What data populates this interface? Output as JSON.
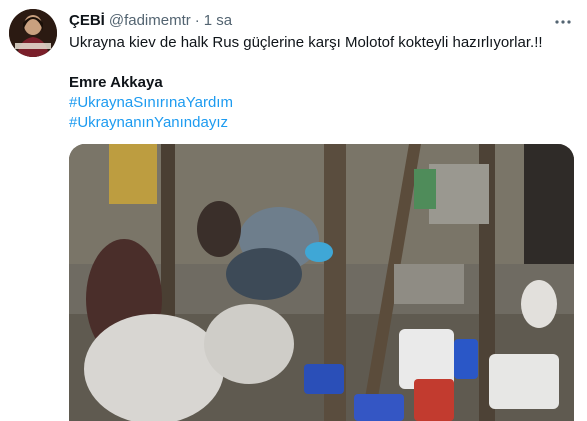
{
  "tweet": {
    "display_name": "ÇEBİ",
    "handle": "@fadimemtr",
    "separator": "·",
    "timestamp": "1 sa",
    "text": "Ukrayna kiev de halk Rus güçlerine karşı Molotof kokteyli hazırlıyorlar.!!",
    "author_line": "Emre Akkaya",
    "hashtags": [
      "#UkraynaSınırınaYardım",
      "#UkraynanınYanındayız"
    ]
  },
  "icons": {
    "more": "more-horizontal-icon",
    "avatar": "profile-photo"
  },
  "colors": {
    "text_primary": "#0f1419",
    "text_secondary": "#536471",
    "hashtag": "#1d9bf0",
    "background": "#ffffff"
  }
}
